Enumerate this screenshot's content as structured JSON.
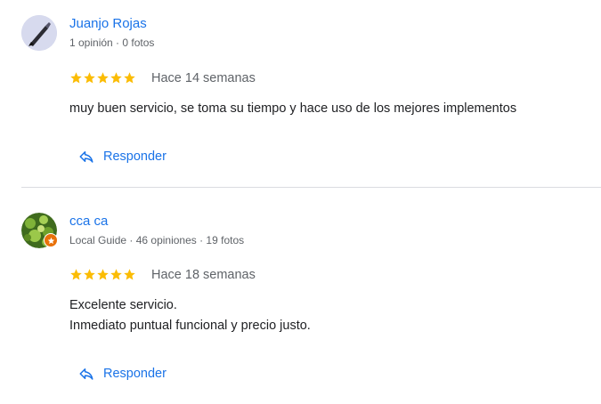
{
  "reviews": [
    {
      "author": "Juanjo Rojas",
      "meta": "1 opinión · 0 fotos",
      "rating": 5,
      "time": "Hace 14 semanas",
      "text_lines": [
        "muy buen servicio, se toma su tiempo y hace uso de los mejores implementos"
      ],
      "reply_label": "Responder"
    },
    {
      "author": "cca ca",
      "meta": "Local Guide · 46 opiniones · 19 fotos",
      "rating": 5,
      "time": "Hace 18 semanas",
      "text_lines": [
        "Excelente servicio.",
        "Inmediato puntual funcional y precio justo."
      ],
      "reply_label": "Responder"
    }
  ],
  "colors": {
    "link": "#1a73e8",
    "star": "#fbbc04",
    "secondary_text": "#5f6368",
    "divider": "#dadce0",
    "local_guide_badge": "#e8710a"
  },
  "icons": {
    "reply": "reply-arrow-icon",
    "star": "star-icon",
    "local_guide": "local-guide-badge-icon"
  }
}
